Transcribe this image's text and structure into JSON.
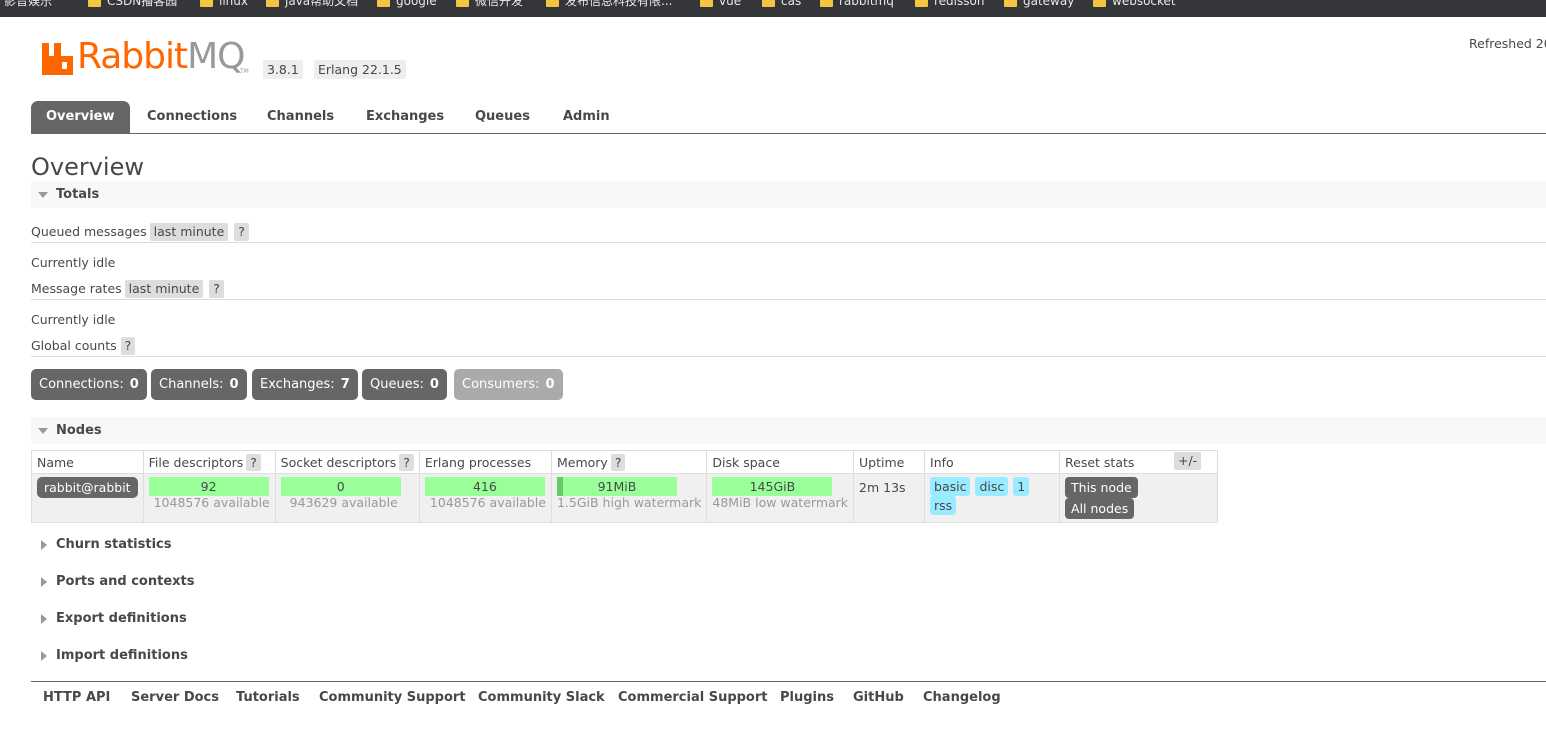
{
  "bookmarks": [
    "影音娱乐",
    "CSDN播客园",
    "linux",
    "java帮助文档",
    "google",
    "微信开发",
    "发布信息科技有限...",
    "vue",
    "cas",
    "rabbitmq",
    "redisson",
    "gateway",
    "websocket"
  ],
  "header": {
    "logo_primary": "Rabbit",
    "logo_secondary": "MQ",
    "logo_tm": "TM",
    "version": "3.8.1",
    "erlang": "Erlang 22.1.5",
    "refreshed": "Refreshed 20"
  },
  "tabs": [
    "Overview",
    "Connections",
    "Channels",
    "Exchanges",
    "Queues",
    "Admin"
  ],
  "page_title": "Overview",
  "totals": {
    "title": "Totals",
    "queued_label": "Queued messages",
    "queued_range": "last minute",
    "help": "?",
    "idle1": "Currently idle",
    "rates_label": "Message rates",
    "rates_range": "last minute",
    "idle2": "Currently idle",
    "global_label": "Global counts"
  },
  "counts": [
    {
      "label": "Connections:",
      "value": "0"
    },
    {
      "label": "Channels:",
      "value": "0"
    },
    {
      "label": "Exchanges:",
      "value": "7"
    },
    {
      "label": "Queues:",
      "value": "0"
    },
    {
      "label": "Consumers:",
      "value": "0"
    }
  ],
  "nodes": {
    "title": "Nodes",
    "columns": [
      "Name",
      "File descriptors",
      "Socket descriptors",
      "Erlang processes",
      "Memory",
      "Disk space",
      "Uptime",
      "Info",
      "Reset stats"
    ],
    "plus_minus": "+/-",
    "row": {
      "name": "rabbit@rabbit",
      "fd": "92",
      "fd_sub": "1048576 available",
      "sd": "0",
      "sd_sub": "943629 available",
      "ep": "416",
      "ep_sub": "1048576 available",
      "mem": "91MiB",
      "mem_sub": "1.5GiB high watermark",
      "disk": "145GiB",
      "disk_sub": "48MiB low watermark",
      "uptime": "2m 13s",
      "info": [
        "basic",
        "disc",
        "1",
        "rss"
      ],
      "reset_this": "This node",
      "reset_all": "All nodes"
    }
  },
  "collapsed_sections": [
    "Churn statistics",
    "Ports and contexts",
    "Export definitions",
    "Import definitions"
  ],
  "footer": [
    "HTTP API",
    "Server Docs",
    "Tutorials",
    "Community Support",
    "Community Slack",
    "Commercial Support",
    "Plugins",
    "GitHub",
    "Changelog"
  ],
  "colors": {
    "brand": "#ff6600",
    "tab_active": "#666666",
    "bar_ok": "#99ff99",
    "info_tag": "#99ebff"
  }
}
